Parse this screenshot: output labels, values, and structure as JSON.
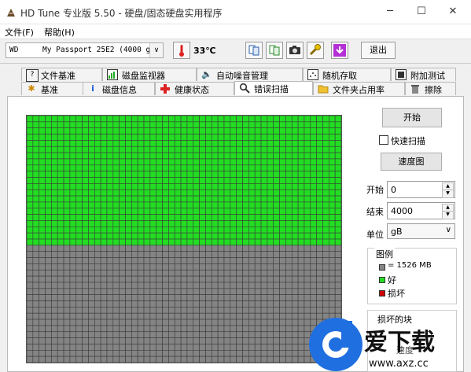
{
  "window": {
    "title": "HD Tune 专业版 5.50 - 硬盘/固态硬盘实用程序"
  },
  "menu": {
    "file": "文件(F)",
    "help": "帮助(H)"
  },
  "toolbar": {
    "drive_brand": "WD",
    "drive_model": "My Passport 25E2 (4000 gB)",
    "temperature": "33℃",
    "exit_label": "退出"
  },
  "tabs_top": [
    {
      "label": "文件基准",
      "icon": "file-benchmark-icon"
    },
    {
      "label": "磁盘监视器",
      "icon": "disk-monitor-icon"
    },
    {
      "label": "自动噪音管理",
      "icon": "speaker-icon"
    },
    {
      "label": "随机存取",
      "icon": "random-access-icon"
    },
    {
      "label": "附加测试",
      "icon": "extra-tests-icon"
    }
  ],
  "tabs_bottom": [
    {
      "label": "基准",
      "icon": "benchmark-icon"
    },
    {
      "label": "磁盘信息",
      "icon": "info-icon"
    },
    {
      "label": "健康状态",
      "icon": "health-icon"
    },
    {
      "label": "错误扫描",
      "icon": "search-icon",
      "active": true
    },
    {
      "label": "文件夹占用率",
      "icon": "folder-icon"
    },
    {
      "label": "擦除",
      "icon": "erase-icon"
    }
  ],
  "scan_grid": {
    "cols": 51,
    "rows": 40,
    "scanned_fraction": 0.525
  },
  "side": {
    "start_button": "开始",
    "quick_scan": "快速扫描",
    "speed_map": "速度图",
    "start_label": "开始",
    "start_value": "0",
    "end_label": "结束",
    "end_value": "4000",
    "unit_label": "单位",
    "unit_value": "gB"
  },
  "legend": {
    "title": "图例",
    "block_size": "= 1526 MB",
    "good": "好",
    "damaged": "损坏"
  },
  "damaged_blocks": {
    "title": "损坏的块",
    "speed_label": "速度"
  },
  "watermark": {
    "text": "爱下载",
    "url": "www.axz.cc"
  },
  "colors": {
    "good": "#22dd22",
    "unscanned": "#848484",
    "damaged": "#cc0000",
    "grid_line": "#3a3a3a"
  }
}
